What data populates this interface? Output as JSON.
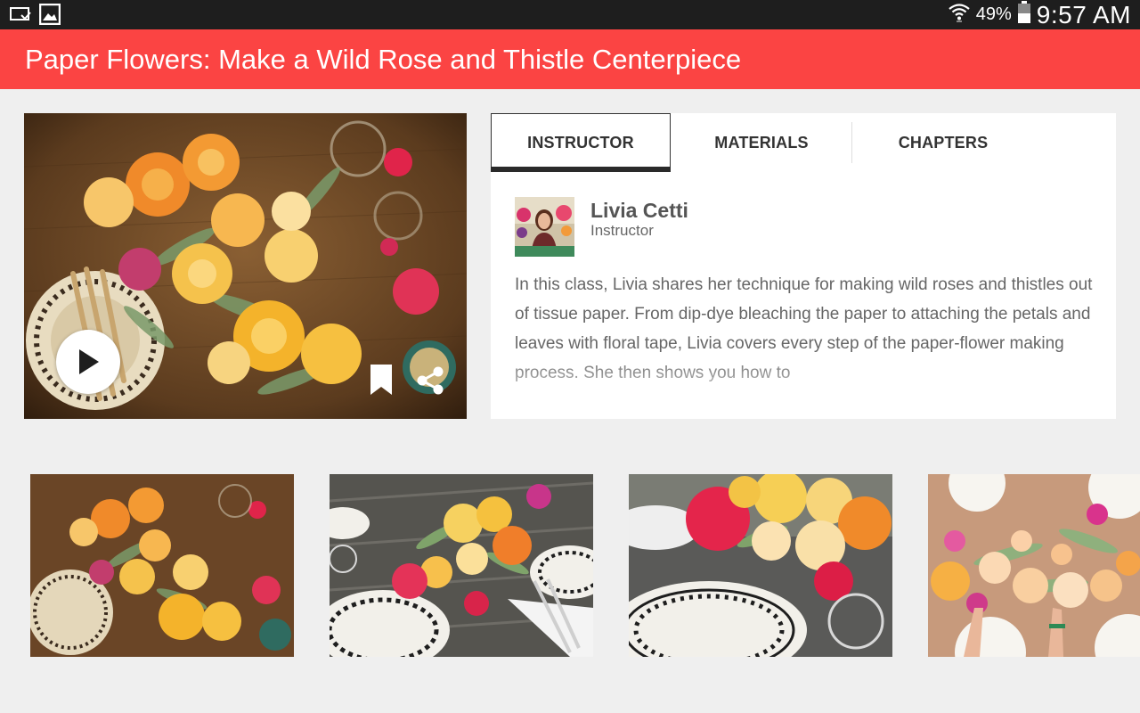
{
  "status_bar": {
    "battery_percent": "49%",
    "time": "9:57 AM",
    "icons": [
      "cast-icon",
      "gallery-icon",
      "wifi-icon",
      "battery-icon"
    ]
  },
  "app_bar": {
    "title": "Paper Flowers: Make a Wild Rose and Thistle Centerpiece"
  },
  "hero": {
    "icons": [
      "play-icon",
      "bookmark-icon",
      "share-icon"
    ]
  },
  "tabs": [
    {
      "label": "INSTRUCTOR",
      "selected": true
    },
    {
      "label": "MATERIALS",
      "selected": false
    },
    {
      "label": "CHAPTERS",
      "selected": false
    }
  ],
  "instructor": {
    "name": "Livia Cetti",
    "role": "Instructor",
    "description": "In this class, Livia shares her technique for making wild roses and thistles out of tissue paper. From dip-dye bleaching the paper to attaching the petals and leaves with floral tape, Livia covers every step of the paper-flower making process. She then shows you how to"
  },
  "colors": {
    "app_bar": "#fb4443",
    "status_bar": "#1e1e1e",
    "background": "#efefef",
    "card": "#ffffff",
    "tab_indicator": "#2a2a2a"
  }
}
